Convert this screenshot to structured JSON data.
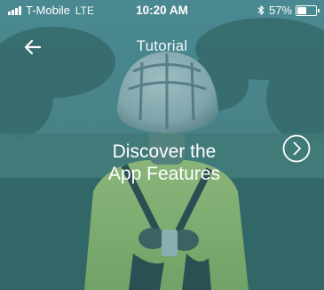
{
  "status_bar": {
    "carrier": "T-Mobile",
    "network": "LTE",
    "time": "10:20 AM",
    "battery_percent": "57%",
    "battery_level": 0.57,
    "signal_bars": 4,
    "bluetooth_icon": "bluetooth-icon"
  },
  "nav": {
    "title": "Tutorial",
    "back_icon": "arrow-left-icon"
  },
  "hero": {
    "heading_line1": "Discover the",
    "heading_line2": "App Features",
    "next_icon": "chevron-right-circle-icon"
  },
  "colors": {
    "tint": "#2f6f78",
    "foreground": "#ffffff",
    "jacket": "#b9d86a"
  }
}
